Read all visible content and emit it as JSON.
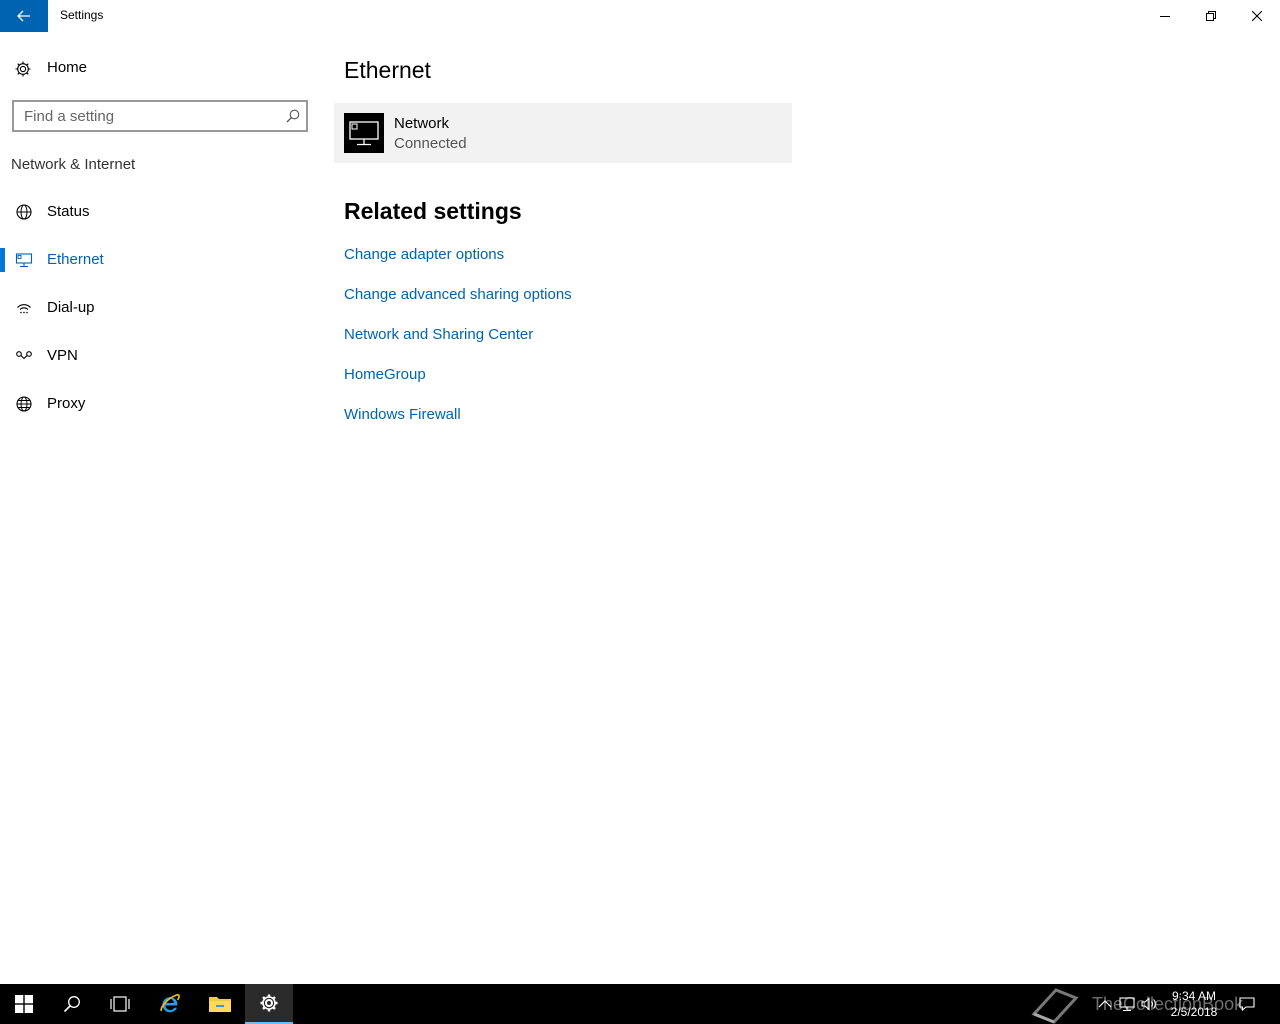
{
  "window": {
    "title": "Settings",
    "back_icon": "arrow-left-icon",
    "controls": [
      "minimize-icon",
      "restore-icon",
      "close-icon"
    ]
  },
  "sidebar": {
    "home_label": "Home",
    "search_placeholder": "Find a setting",
    "section_label": "Network & Internet",
    "items": [
      {
        "label": "Status",
        "icon": "globe-status-icon",
        "active": false
      },
      {
        "label": "Ethernet",
        "icon": "ethernet-icon",
        "active": true
      },
      {
        "label": "Dial-up",
        "icon": "dialup-icon",
        "active": false
      },
      {
        "label": "VPN",
        "icon": "vpn-icon",
        "active": false
      },
      {
        "label": "Proxy",
        "icon": "globe-icon",
        "active": false
      }
    ]
  },
  "main": {
    "title": "Ethernet",
    "network": {
      "name": "Network",
      "status": "Connected",
      "icon": "ethernet-monitor-icon"
    },
    "related_title": "Related settings",
    "links": [
      "Change adapter options",
      "Change advanced sharing options",
      "Network and Sharing Center",
      "HomeGroup",
      "Windows Firewall"
    ]
  },
  "taskbar": {
    "buttons": [
      "windows-start-icon",
      "search-icon",
      "task-view-icon",
      "internet-explorer-icon",
      "file-explorer-icon",
      "settings-gear-icon"
    ],
    "active_button": "settings-gear-icon",
    "clock_time": "9:34 AM",
    "clock_date": "2/5/2018",
    "watermark": "TheCollectionBook"
  },
  "colors": {
    "accent": "#0063b1",
    "active_indicator": "#0078d7",
    "taskbar": "#000000",
    "card_bg": "#f2f2f2"
  }
}
